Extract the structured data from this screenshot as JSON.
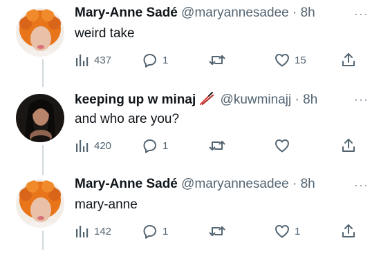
{
  "tweets": [
    {
      "name": "Mary-Anne Sadé",
      "handle": "@maryannesadee",
      "dot": "·",
      "time": "8h",
      "text": "weird take",
      "views": "437",
      "replies": "1",
      "retweets": "",
      "likes": "15",
      "avatar": "orange-curly-hair-avatar"
    },
    {
      "name": "keeping up w minaj",
      "name_emoji": "chopsticks-emoji",
      "handle": "@kuwminajj",
      "dot": "·",
      "time": "8h",
      "text": "and who are you?",
      "views": "420",
      "replies": "1",
      "retweets": "",
      "likes": "",
      "avatar": "dark-hair-avatar"
    },
    {
      "name": "Mary-Anne Sadé",
      "handle": "@maryannesadee",
      "dot": "·",
      "time": "8h",
      "text": "mary-anne",
      "views": "142",
      "replies": "1",
      "retweets": "",
      "likes": "1",
      "avatar": "orange-curly-hair-avatar"
    }
  ],
  "colors": {
    "text": "#0f1419",
    "secondary": "#536471",
    "thread_line": "#cfd9de",
    "accent_orange": "#e8751a"
  }
}
